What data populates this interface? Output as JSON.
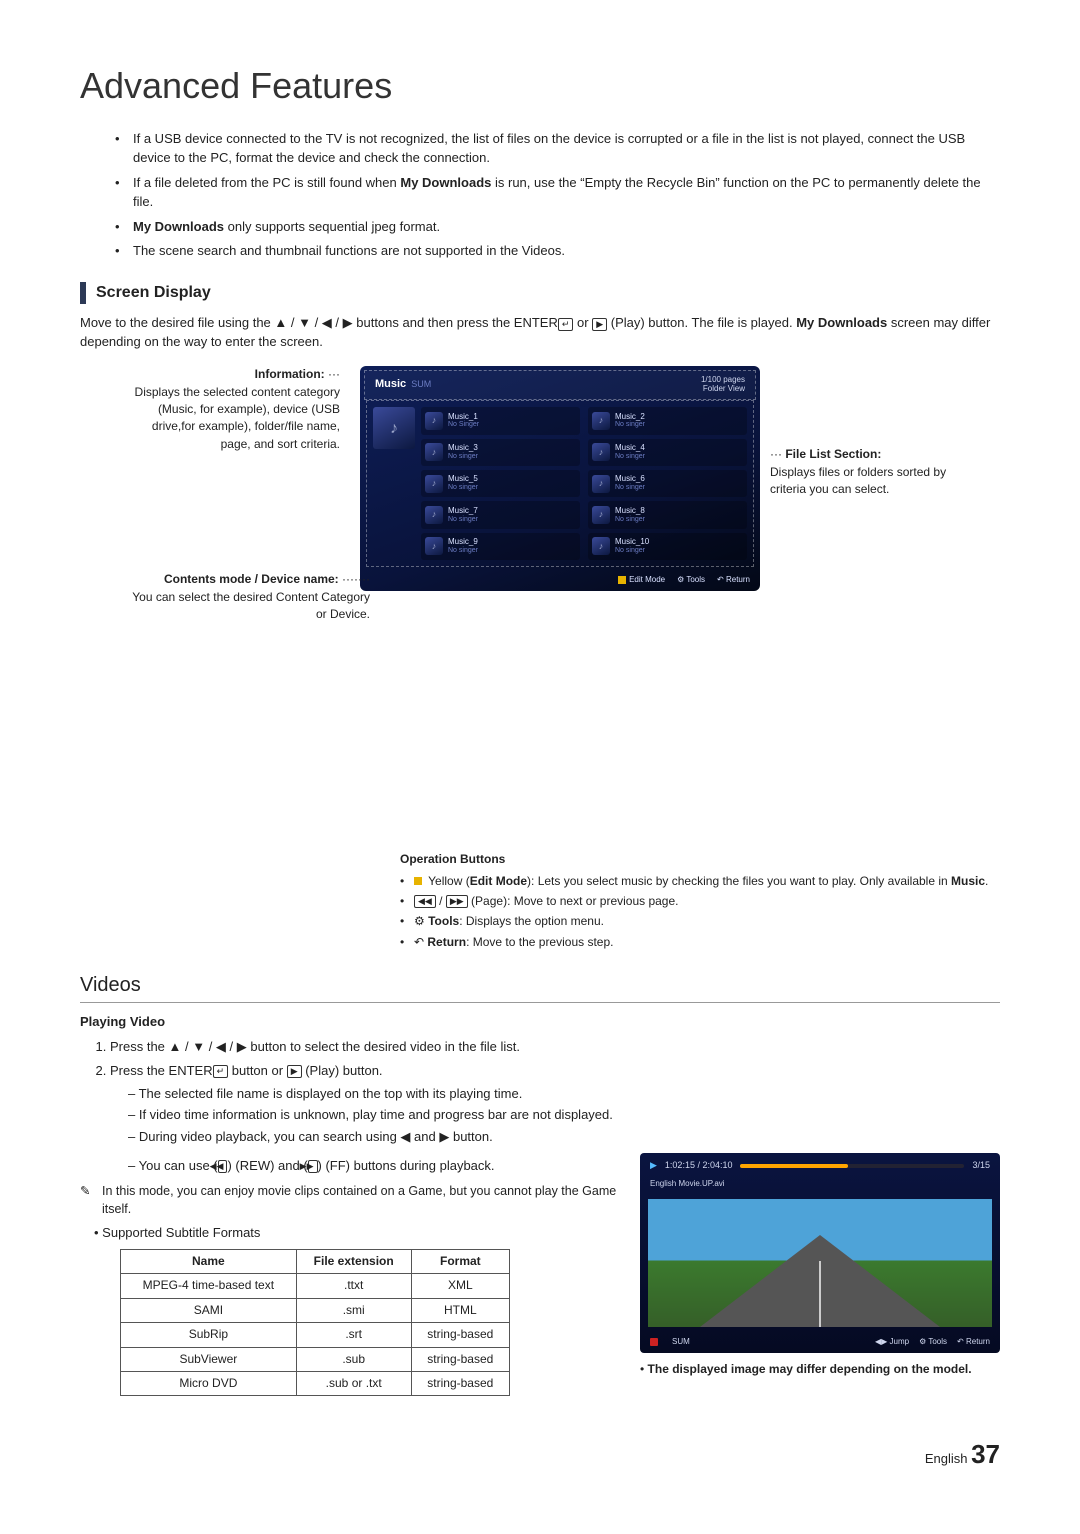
{
  "page_title": "Advanced Features",
  "top_bullets": [
    "If a USB device connected to the TV is not recognized, the list of files on the device is corrupted or a file in the list is not played, connect the USB device to the PC, format the device and check the connection.",
    "If a file deleted from the PC is still found when My Downloads is run, use the \"Empty the Recycle Bin\" function on the PC to permanently delete the file.",
    "My Downloads only supports sequential jpeg format.",
    "The scene search and thumbnail functions are not supported in the Videos."
  ],
  "bold_inline": {
    "my_downloads": "My Downloads"
  },
  "screen_display": {
    "heading": "Screen Display",
    "desc_pre": "Move to the desired file using the ",
    "desc_arrows": "▲ / ▼ / ◀ / ▶",
    "desc_mid": " buttons and then press the ENTER",
    "desc_or": " or ",
    "desc_play_suffix": " (Play) button. The file is played. ",
    "desc_tail": " screen may differ depending on the way to enter the screen."
  },
  "info_left": {
    "title": "Information:",
    "body": "Displays the selected content category (Music, for example), device (USB drive,for example), folder/file name, page, and sort criteria."
  },
  "info_right": {
    "title": "File List Section:",
    "body": "Displays files or folders sorted by criteria you can select."
  },
  "contents_box": {
    "title": "Contents mode / Device name:",
    "body": "You can select the desired Content Category or Device."
  },
  "player": {
    "title": "Music",
    "sum": "SUM",
    "pageno": "1/100 pages",
    "folder": "Folder View",
    "tiles": [
      {
        "t": "Music_1",
        "s": "No Singer"
      },
      {
        "t": "Music_2",
        "s": "No singer"
      },
      {
        "t": "Music_3",
        "s": "No singer"
      },
      {
        "t": "Music_4",
        "s": "No singer"
      },
      {
        "t": "Music_5",
        "s": "No singer"
      },
      {
        "t": "Music_6",
        "s": "No singer"
      },
      {
        "t": "Music_7",
        "s": "No singer"
      },
      {
        "t": "Music_8",
        "s": "No singer"
      },
      {
        "t": "Music_9",
        "s": "No singer"
      },
      {
        "t": "Music_10",
        "s": "No singer"
      }
    ],
    "footer": {
      "edit": "Edit Mode",
      "tools": "Tools",
      "return": "Return"
    }
  },
  "opbuttons": {
    "heading": "Operation Buttons",
    "yellow_pre": "Yellow (",
    "yellow_bold": "Edit Mode",
    "yellow_post": "): Lets you select music by checking the files you want to play. Only available in ",
    "yellow_music": "Music",
    "page": "(Page): Move to next or previous page.",
    "tools_label": "Tools",
    "tools_text": ": Displays the option menu.",
    "return_label": "Return",
    "return_text": ": Move to the previous step."
  },
  "videos_heading": "Videos",
  "playing_video": {
    "heading": "Playing Video",
    "step1_pre": "Press the ",
    "step1_arrows": "▲ / ▼ / ◀ / ▶",
    "step1_post": " button to select the desired video in the file list.",
    "step2_pre": "Press the ENTER",
    "step2_mid": " button or ",
    "step2_post": " (Play) button.",
    "dash": [
      "The selected file name is displayed on the top with its playing time.",
      "If video time information is unknown, play time and progress bar are not displayed.",
      "During video playback, you can search using ◀ and ▶ button.",
      "You can use (◀◀) (REW) and (▶▶) (FF) buttons during playback."
    ],
    "note": "In this mode, you can enjoy movie clips contained on a Game, but you cannot play the Game itself.",
    "supported": "Supported Subtitle Formats"
  },
  "subtitle_table": {
    "headers": [
      "Name",
      "File extension",
      "Format"
    ],
    "rows": [
      [
        "MPEG-4 time-based text",
        ".ttxt",
        "XML"
      ],
      [
        "SAMI",
        ".smi",
        "HTML"
      ],
      [
        "SubRip",
        ".srt",
        "string-based"
      ],
      [
        "SubViewer",
        ".sub",
        "string-based"
      ],
      [
        "Micro DVD",
        ".sub or .txt",
        "string-based"
      ]
    ]
  },
  "videoplayer": {
    "time": "1:02:15 / 2:04:10",
    "count": "3/15",
    "fname": "English Movie.UP.avi",
    "sum": "SUM",
    "jump": "Jump",
    "tools": "Tools",
    "return": "Return"
  },
  "img_note": "The displayed image may differ depending on the model.",
  "footer": {
    "lang": "English",
    "page": "37"
  }
}
